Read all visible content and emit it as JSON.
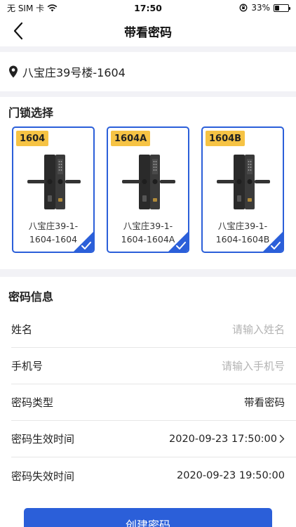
{
  "status_bar": {
    "carrier": "无 SIM 卡",
    "time": "17:50",
    "battery": "33%",
    "battery_level": 0.33
  },
  "nav": {
    "title": "带看密码"
  },
  "address": {
    "text": "八宝庄39号楼-1604"
  },
  "lock_section": {
    "title": "门锁选择",
    "locks": [
      {
        "tag": "1604",
        "name": "八宝庄39-1-1604-1604",
        "selected": true
      },
      {
        "tag": "1604A",
        "name": "八宝庄39-1-1604-1604A",
        "selected": true
      },
      {
        "tag": "1604B",
        "name": "八宝庄39-1-1604-1604B",
        "selected": true
      }
    ]
  },
  "password_section": {
    "title": "密码信息",
    "name_label": "姓名",
    "name_placeholder": "请输入姓名",
    "phone_label": "手机号",
    "phone_placeholder": "请输入手机号",
    "type_label": "密码类型",
    "type_value": "带看密码",
    "start_label": "密码生效时间",
    "start_value": "2020-09-23 17:50:00",
    "end_label": "密码失效时间",
    "end_value": "2020-09-23 19:50:00"
  },
  "create_button": {
    "label": "创建密码"
  },
  "colors": {
    "accent": "#2b5fd9",
    "tag": "#f6c344",
    "background_gap": "#f2f2f6"
  }
}
